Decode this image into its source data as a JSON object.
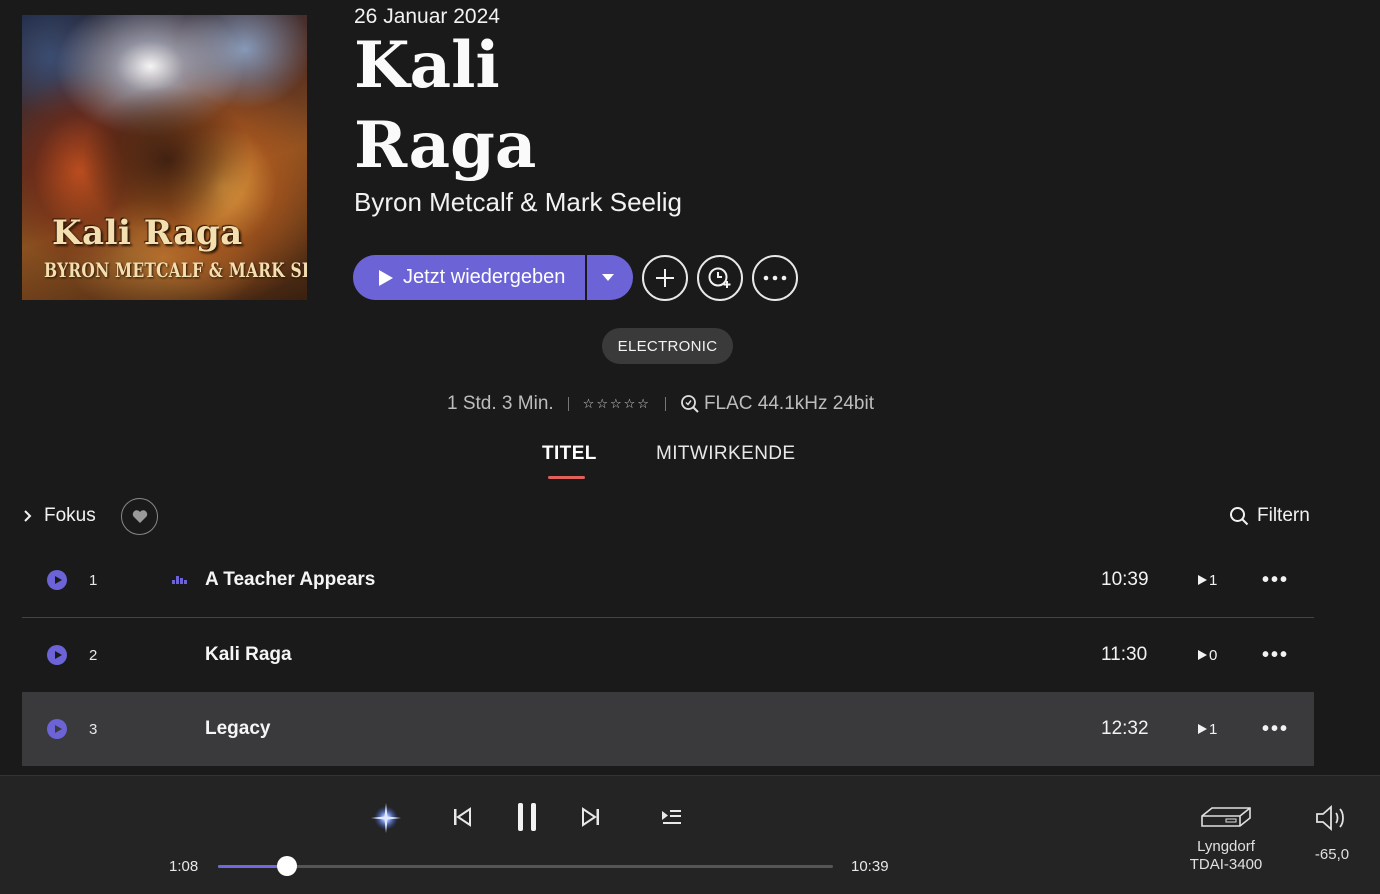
{
  "album": {
    "cover_title": "Kali Raga",
    "cover_artists": "BYRON METCALF & MARK SEELIG",
    "release_date": "26 Januar 2024",
    "title_line1": "Kali",
    "title_line2": "Raga",
    "artist": "Byron Metcalf & Mark Seelig"
  },
  "actions": {
    "play_label": "Jetzt wiedergeben",
    "add_icon": "plus-icon",
    "timer_icon": "clock-add-icon",
    "more_icon": "more-icon"
  },
  "genre": "ELECTRONIC",
  "meta": {
    "duration": "1 Std. 3 Min.",
    "rating_stars": "☆☆☆☆☆",
    "format": "FLAC 44.1kHz 24bit"
  },
  "tabs": [
    {
      "label": "TITEL",
      "active": true
    },
    {
      "label": "MITWIRKENDE",
      "active": false
    }
  ],
  "toolbar": {
    "focus_label": "Fokus",
    "filter_label": "Filtern"
  },
  "tracks": [
    {
      "num": "1",
      "title": "A Teacher Appears",
      "duration": "10:39",
      "plays": "1",
      "playing": true,
      "selected": false
    },
    {
      "num": "2",
      "title": "Kali Raga",
      "duration": "11:30",
      "plays": "0",
      "playing": false,
      "selected": false
    },
    {
      "num": "3",
      "title": "Legacy",
      "duration": "12:32",
      "plays": "1",
      "playing": false,
      "selected": true
    }
  ],
  "player": {
    "elapsed": "1:08",
    "total": "10:39",
    "progress_fraction": 0.113,
    "device_line1": "Lyngdorf",
    "device_line2": "TDAI-3400",
    "volume": "-65,0"
  },
  "colors": {
    "accent": "#6b63d6",
    "tab_underline": "#e0605a",
    "background": "#1a1a1a"
  }
}
